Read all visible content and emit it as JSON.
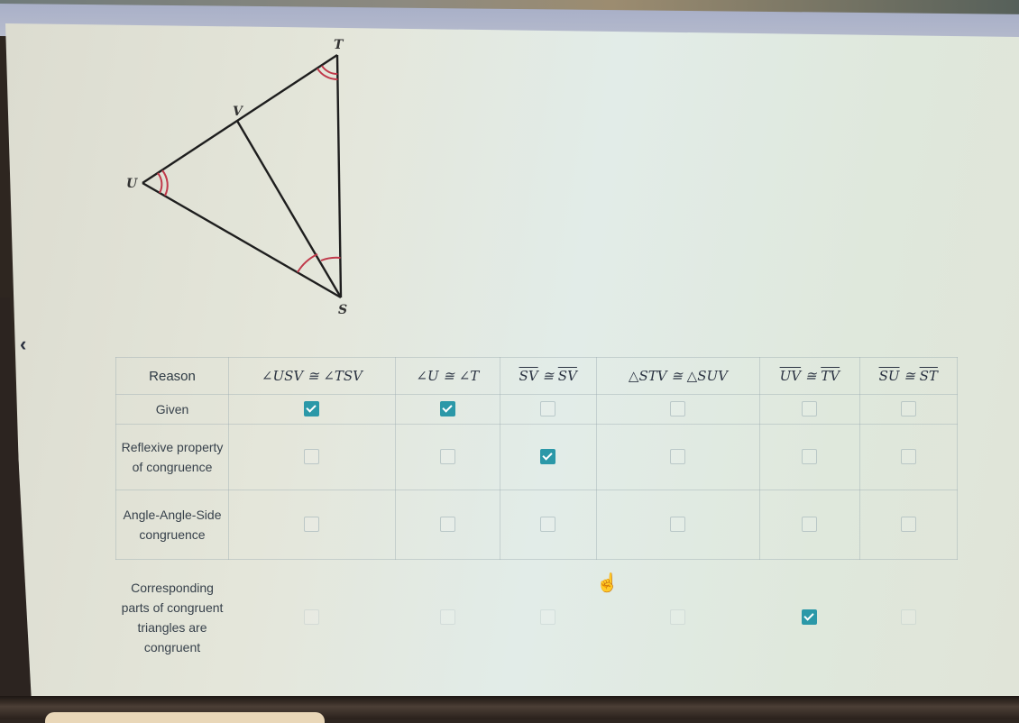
{
  "diagram": {
    "vertices": {
      "T": "T",
      "V": "V",
      "U": "U",
      "S": "S"
    },
    "segments": [
      "TU",
      "TS",
      "US",
      "VS"
    ],
    "angle_marks": [
      {
        "vertex": "T",
        "arcs": 2,
        "color": "#c0394a"
      },
      {
        "vertex": "U",
        "arcs": 2,
        "color": "#c0394a"
      },
      {
        "vertex": "S",
        "arcs": 1,
        "split_by": "SV",
        "color": "#c0394a"
      }
    ]
  },
  "nav": {
    "back_icon": "‹"
  },
  "table": {
    "header": {
      "reason": "Reason",
      "statements": [
        {
          "text": "∠USV ≅ ∠TSV",
          "overline": false
        },
        {
          "text": "∠U ≅ ∠T",
          "overline": false
        },
        {
          "left": "SV",
          "op": "≅",
          "right": "SV",
          "overline": true
        },
        {
          "text": "△STV ≅ △SUV",
          "overline": false
        },
        {
          "left": "UV",
          "op": "≅",
          "right": "TV",
          "overline": true
        },
        {
          "left": "SU",
          "op": "≅",
          "right": "ST",
          "overline": true
        }
      ]
    },
    "rows": [
      {
        "reason": "Given",
        "checks": [
          true,
          true,
          false,
          false,
          false,
          false
        ]
      },
      {
        "reason": "Reflexive property of congruence",
        "checks": [
          false,
          false,
          true,
          false,
          false,
          false
        ]
      },
      {
        "reason": "Angle-Angle-Side congruence",
        "checks": [
          false,
          false,
          false,
          false,
          false,
          false
        ]
      },
      {
        "reason": "Corresponding parts of congruent triangles are congruent",
        "checks": [
          false,
          false,
          false,
          false,
          true,
          false
        ]
      }
    ],
    "accent_color": "#2b98a8"
  },
  "cursor": {
    "type": "hand-pointer"
  }
}
